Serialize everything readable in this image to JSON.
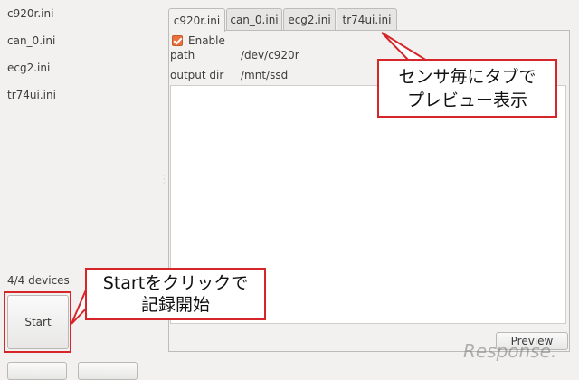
{
  "sidebar": {
    "files": [
      "c920r.ini",
      "can_0.ini",
      "ecg2.ini",
      "tr74ui.ini"
    ],
    "device_count": "4/4 devices",
    "start_label": "Start"
  },
  "tabs": [
    "c920r.ini",
    "can_0.ini",
    "ecg2.ini",
    "tr74ui.ini"
  ],
  "active_tab": "c920r.ini",
  "panel": {
    "enable_label": "Enable",
    "enable_checked": true,
    "fields": [
      {
        "label": "path",
        "value": "/dev/c920r"
      },
      {
        "label": "output dir",
        "value": "/mnt/ssd"
      }
    ],
    "preview_label": "Preview"
  },
  "annotations": {
    "tabs_note": [
      "センサ毎にタブで",
      "プレビュー表示"
    ],
    "start_note": [
      "Startをクリックで",
      "記録開始"
    ]
  },
  "watermark": "Response.",
  "colors": {
    "accent_checkbox": "#e9713e",
    "callout_border": "#d6262a",
    "window_bg": "#f2f1f0"
  }
}
